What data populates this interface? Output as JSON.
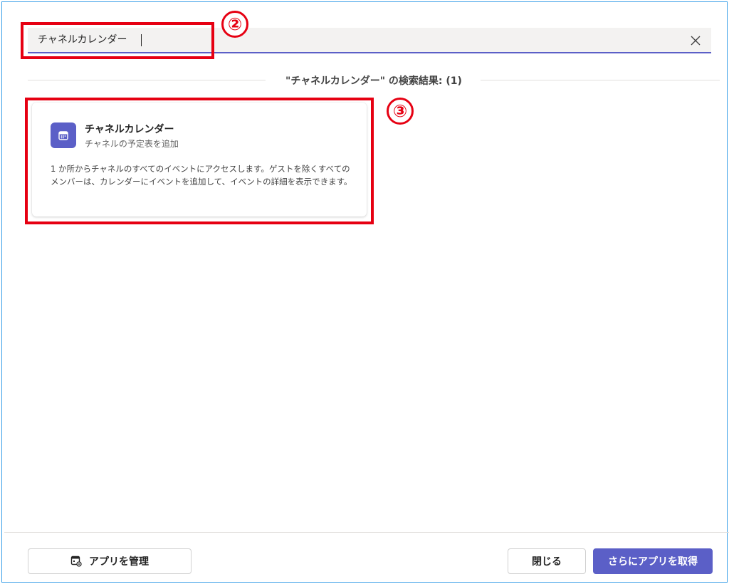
{
  "search": {
    "value": "チャネルカレンダー",
    "clear_icon": "close-icon"
  },
  "results": {
    "title": "\"チャネルカレンダー\" の検索結果: (1)"
  },
  "app_card": {
    "icon": "calendar-icon",
    "name": "チャネルカレンダー",
    "subtitle": "チャネルの予定表を追加",
    "description": "1 か所からチャネルのすべてのイベントにアクセスします。ゲストを除くすべてのメンバーは、カレンダーにイベントを追加して、イベントの詳細を表示できます。"
  },
  "annotations": {
    "step2": "②",
    "step3": "③"
  },
  "footer": {
    "manage_label": "アプリを管理",
    "manage_icon": "manage-apps-icon",
    "close_label": "閉じる",
    "more_label": "さらにアプリを取得"
  },
  "colors": {
    "accent": "#5b5fc7",
    "annotation": "#e60012"
  }
}
